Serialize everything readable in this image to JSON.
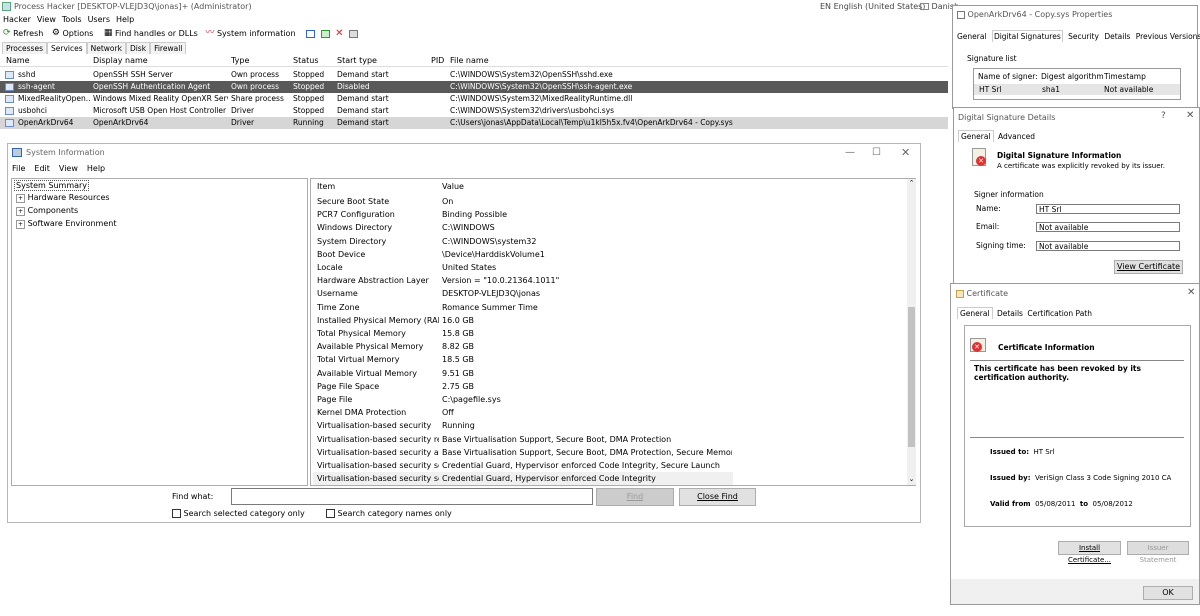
{
  "process_hacker": {
    "title": "Process Hacker [DESKTOP-VLEJD3Q\\jonas]+ (Administrator)",
    "menu": [
      "Hacker",
      "View",
      "Tools",
      "Users",
      "Help"
    ],
    "toolbar": {
      "refresh": "Refresh",
      "options": "Options",
      "find": "Find handles or DLLs",
      "sysinfo": "System information"
    },
    "tabs": [
      "Processes",
      "Services",
      "Network",
      "Disk",
      "Firewall"
    ],
    "columns": [
      "Name",
      "Display name",
      "Type",
      "Status",
      "Start type",
      "PID",
      "File name"
    ],
    "rows": [
      {
        "name": "sshd",
        "display": "OpenSSH SSH Server",
        "type": "Own process",
        "status": "Stopped",
        "start": "Demand start",
        "file": "C:\\WINDOWS\\System32\\OpenSSH\\sshd.exe"
      },
      {
        "name": "ssh-agent",
        "display": "OpenSSH Authentication Agent",
        "type": "Own process",
        "status": "Stopped",
        "start": "Disabled",
        "file": "C:\\WINDOWS\\System32\\OpenSSH\\ssh-agent.exe"
      },
      {
        "name": "MixedRealityOpen...",
        "display": "Windows Mixed Reality OpenXR Servi...",
        "type": "Share process",
        "status": "Stopped",
        "start": "Demand start",
        "file": "C:\\WINDOWS\\System32\\MixedRealityRuntime.dll"
      },
      {
        "name": "usbohci",
        "display": "Microsoft USB Open Host Controller ...",
        "type": "Driver",
        "status": "Stopped",
        "start": "Demand start",
        "file": "C:\\WINDOWS\\System32\\drivers\\usbohci.sys"
      },
      {
        "name": "OpenArkDrv64",
        "display": "OpenArkDrv64",
        "type": "Driver",
        "status": "Running",
        "start": "Demand start",
        "file": "C:\\Users\\jonas\\AppData\\Local\\Temp\\u1kl5h5x.fv4\\OpenArkDrv64 - Copy.sys"
      }
    ]
  },
  "taskbar": {
    "language": "EN English (United States)",
    "user": "Danish"
  },
  "sysinfo": {
    "title": "System Information",
    "menu": [
      "File",
      "Edit",
      "View",
      "Help"
    ],
    "tree": [
      "System Summary",
      "Hardware Resources",
      "Components",
      "Software Environment"
    ],
    "col_item": "Item",
    "col_value": "Value",
    "rows": [
      [
        "Secure Boot State",
        "On"
      ],
      [
        "PCR7 Configuration",
        "Binding Possible"
      ],
      [
        "Windows Directory",
        "C:\\WINDOWS"
      ],
      [
        "System Directory",
        "C:\\WINDOWS\\system32"
      ],
      [
        "Boot Device",
        "\\Device\\HarddiskVolume1"
      ],
      [
        "Locale",
        "United States"
      ],
      [
        "Hardware Abstraction Layer",
        "Version = \"10.0.21364.1011\""
      ],
      [
        "Username",
        "DESKTOP-VLEJD3Q\\jonas"
      ],
      [
        "Time Zone",
        "Romance Summer Time"
      ],
      [
        "Installed Physical Memory (RAM)",
        "16.0 GB"
      ],
      [
        "Total Physical Memory",
        "15.8 GB"
      ],
      [
        "Available Physical Memory",
        "8.82 GB"
      ],
      [
        "Total Virtual Memory",
        "18.5 GB"
      ],
      [
        "Available Virtual Memory",
        "9.51 GB"
      ],
      [
        "Page File Space",
        "2.75 GB"
      ],
      [
        "Page File",
        "C:\\pagefile.sys"
      ],
      [
        "Kernel DMA Protection",
        "Off"
      ],
      [
        "Virtualisation-based security",
        "Running"
      ],
      [
        "Virtualisation-based security re...",
        "Base Virtualisation Support, Secure Boot, DMA Protection"
      ],
      [
        "Virtualisation-based security av...",
        "Base Virtualisation Support, Secure Boot, DMA Protection, Secure Memory Ov..."
      ],
      [
        "Virtualisation-based security se...",
        "Credential Guard, Hypervisor enforced Code Integrity, Secure Launch"
      ],
      [
        "Virtualisation-based security se...",
        "Credential Guard, Hypervisor enforced Code Integrity"
      ]
    ],
    "find_label": "Find what:",
    "find_value": "",
    "find_btn": "Find",
    "close_find_btn": "Close Find",
    "chk_selected": "Search selected category only",
    "chk_names": "Search category names only"
  },
  "props": {
    "title": "OpenArkDrv64 - Copy.sys Properties",
    "tabs": [
      "General",
      "Digital Signatures",
      "Security",
      "Details",
      "Previous Versions"
    ],
    "sig_list_label": "Signature list",
    "cols": [
      "Name of signer:",
      "Digest algorithm",
      "Timestamp"
    ],
    "row": [
      "HT Srl",
      "sha1",
      "Not available"
    ]
  },
  "dsd": {
    "title": "Digital Signature Details",
    "help": "?",
    "tabs": [
      "General",
      "Advanced"
    ],
    "heading": "Digital Signature Information",
    "message": "A certificate was explicitly revoked by its issuer.",
    "signer_info": "Signer information",
    "name_label": "Name:",
    "name_value": "HT Srl",
    "email_label": "Email:",
    "email_value": "Not available",
    "time_label": "Signing time:",
    "time_value": "Not available",
    "view_cert": "View Certificate"
  },
  "cert": {
    "title": "Certificate",
    "tabs": [
      "General",
      "Details",
      "Certification Path"
    ],
    "heading": "Certificate Information",
    "message": "This certificate has been revoked by its certification authority.",
    "issued_to_label": "Issued to:",
    "issued_to": "HT Srl",
    "issued_by_label": "Issued by:",
    "issued_by": "VeriSign Class 3 Code Signing 2010 CA",
    "valid_from_label": "Valid from",
    "valid_from": "05/08/2011",
    "to_label": "to",
    "valid_to": "05/08/2012",
    "install_btn": "Install Certificate...",
    "issuer_btn": "Issuer Statement",
    "ok_btn": "OK"
  }
}
